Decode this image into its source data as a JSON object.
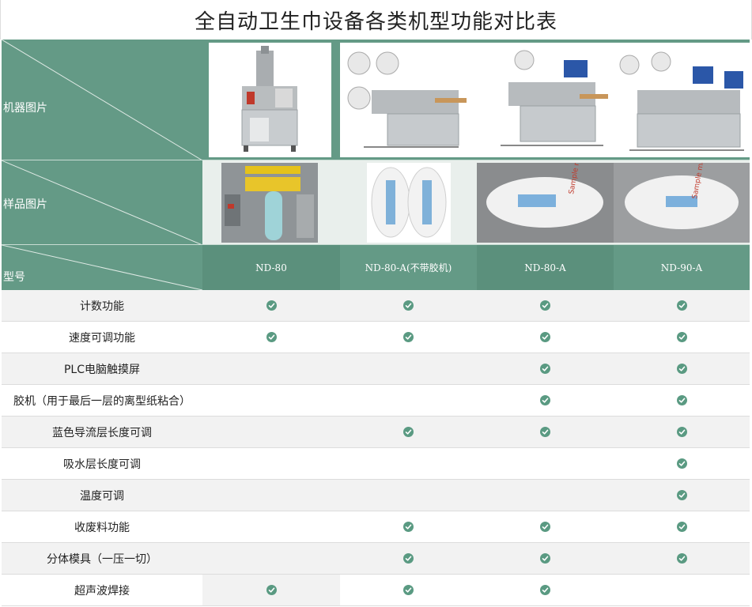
{
  "title": "全自动卫生巾设备各类机型功能对比表",
  "header": {
    "machine_label": "机器图片",
    "sample_label": "样品图片",
    "model_label": "型号"
  },
  "models": [
    "ND-80",
    "ND-80-A(不带胶机)",
    "ND-80-A",
    "ND-90-A"
  ],
  "sample_text": {
    "s3": "Sample made by ND80A",
    "s4": "Sample made by ND90A"
  },
  "features": [
    {
      "label": "计数功能",
      "checks": [
        true,
        true,
        true,
        true
      ]
    },
    {
      "label": "速度可调功能",
      "checks": [
        true,
        true,
        true,
        true
      ]
    },
    {
      "label": "PLC电脑触摸屏",
      "checks": [
        false,
        false,
        true,
        true
      ]
    },
    {
      "label": "胶机（用于最后一层的离型纸粘合）",
      "checks": [
        false,
        false,
        true,
        true
      ]
    },
    {
      "label": "蓝色导流层长度可调",
      "checks": [
        false,
        true,
        true,
        true
      ]
    },
    {
      "label": "吸水层长度可调",
      "checks": [
        false,
        false,
        false,
        true
      ]
    },
    {
      "label": "温度可调",
      "checks": [
        false,
        false,
        false,
        true
      ]
    },
    {
      "label": "收废料功能",
      "checks": [
        false,
        true,
        true,
        true
      ]
    },
    {
      "label": "分体模具（一压一切）",
      "checks": [
        false,
        true,
        true,
        true
      ]
    },
    {
      "label": "超声波焊接",
      "checks": [
        true,
        true,
        true,
        false
      ]
    }
  ],
  "colors": {
    "header_green": "#649a86",
    "check_green": "#5a9a82"
  },
  "icons": {
    "check": "check-circle-icon"
  }
}
